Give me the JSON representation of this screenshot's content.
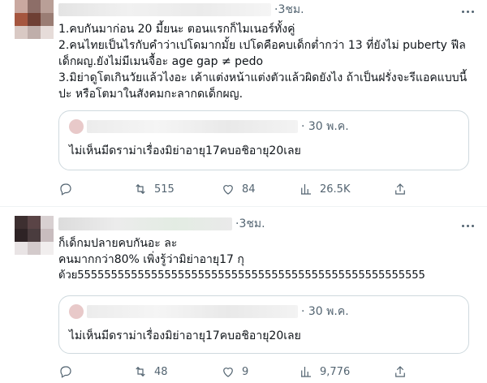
{
  "colors": {
    "text": "#0f1419",
    "secondary": "#536471",
    "border": "#cfd9de"
  },
  "tweets": [
    {
      "time": "·3ชม.",
      "lines": [
        "1.คบกันมาก่อน 20 มี้ยนะ ตอนแรกก็ไมเนอร์ทั้งคู่",
        "2.คนไทยเป็นไรกับคำว่าเปโดมากมั้ย เปโดคือคบเด็กต่ำกว่า 13 ที่ยังไม่ puberty ฟีล",
        "เด็กผญ.ยังไม่มีเมนจื้อะ age gap ≠ pedo",
        "3.มิย่าดูโตเกินวัยแล้วไงอะ เค้าแต่งหน้าแต่งตัวแล้วผิดยังไง ถ้าเป็นฝรั่งจะรีแอคแบบนี้",
        "ปะ หรือโตมาในสังคมกะลากดเด็กผญ."
      ],
      "quote": {
        "time": "· 30 พ.ค.",
        "text": "ไม่เห็นมีดราม่าเรื่องมิย่าอายุ17คบอชิอายุ20เลย"
      },
      "actions": {
        "reply": "",
        "retweet": "515",
        "like": "84",
        "views": "26.5K",
        "share_icon": "share-icon"
      }
    },
    {
      "time": "·3ชม.",
      "lines": [
        "ก็เด็กมปลายคบกันอะ ละ",
        "คนมากกว่า80% เพิ่งรู้ว่ามิย่าอายุ17 กุ",
        "ด้วย5555555555555555555555555555555555555555555555555555"
      ],
      "quote": {
        "time": "· 30 พ.ค.",
        "text": "ไม่เห็นมีดราม่าเรื่องมิย่าอายุ17คบอชิอายุ20เลย"
      },
      "actions": {
        "reply": "",
        "retweet": "48",
        "like": "9",
        "views": "9,776",
        "share_icon": "share-icon"
      }
    }
  ]
}
